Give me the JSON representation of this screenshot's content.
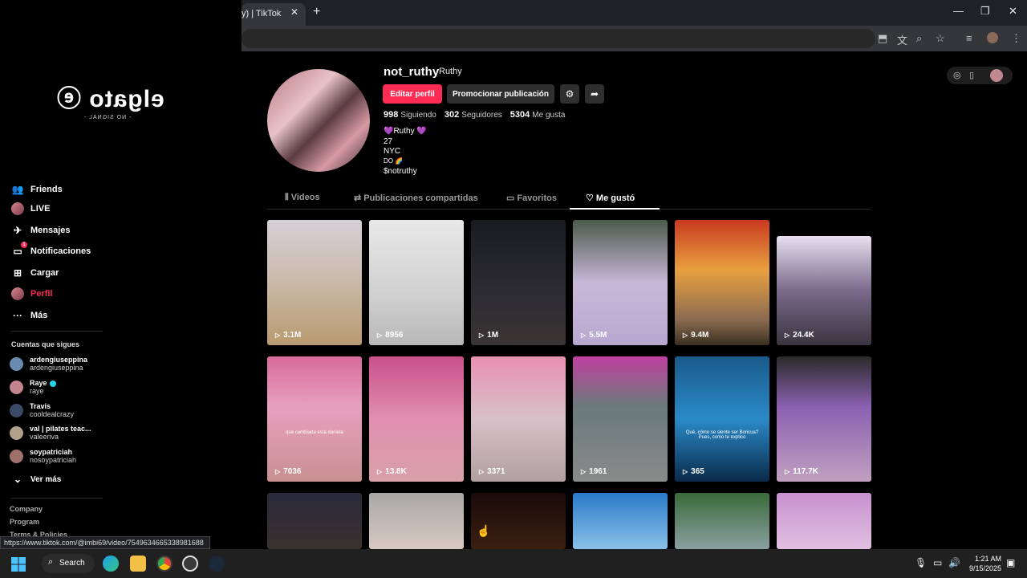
{
  "browser": {
    "tab_title": "y) | TikTok",
    "close_glyph": "✕",
    "new_tab_glyph": "+",
    "minimize_glyph": "—",
    "restore_glyph": "❐",
    "close_window_glyph": "✕"
  },
  "overlay": {
    "logo_text": "elgato",
    "subtitle": "- NO SIGNAL -"
  },
  "sidebar": {
    "items": [
      {
        "label": "Friends",
        "icon": "friends-icon",
        "glyph": "👥"
      },
      {
        "label": "LIVE",
        "icon": "live-avatar-icon",
        "glyph": ""
      },
      {
        "label": "Mensajes",
        "icon": "messages-icon",
        "glyph": "✈"
      },
      {
        "label": "Notificaciones",
        "icon": "notifications-icon",
        "glyph": "💬",
        "badge": "1"
      },
      {
        "label": "Cargar",
        "icon": "upload-icon",
        "glyph": "⊞"
      },
      {
        "label": "Perfil",
        "icon": "profile-avatar-icon",
        "glyph": ""
      },
      {
        "label": "Más",
        "icon": "more-icon",
        "glyph": "···"
      }
    ],
    "following_title": "Cuentas que sigues",
    "following": [
      {
        "name": "ardengiuseppina",
        "username": "ardengiuseppina",
        "color": "#6a8bb0"
      },
      {
        "name": "Raye",
        "username": "raye",
        "verified": true,
        "color": "#c4848f"
      },
      {
        "name": "Travis",
        "username": "cooldealcrazy",
        "color": "#3a4a66"
      },
      {
        "name": "val | pilates teac...",
        "username": "valeeriva",
        "color": "#b3a08a"
      },
      {
        "name": "soypatriciah",
        "username": "nosoypatriciah",
        "color": "#a0706a"
      }
    ],
    "see_more": "Ver más",
    "footer_links": [
      "Company",
      "Program",
      "Terms & Policies"
    ]
  },
  "profile": {
    "username": "not_ruthy",
    "display_name": "Ruthy",
    "edit_button": "Editar perfil",
    "promote_button": "Promocionar publicación",
    "stats": [
      {
        "value": "998",
        "label": "Siguiendo"
      },
      {
        "value": "302",
        "label": "Seguidores"
      },
      {
        "value": "5304",
        "label": "Me gusta"
      }
    ],
    "bio_lines": [
      "💜Ruthy 💜",
      "27",
      "NYC",
      "DO 🌈",
      "$notruthy"
    ]
  },
  "tabs": [
    {
      "label": "Videos",
      "icon": "grid-icon",
      "glyph": "⫴"
    },
    {
      "label": "Publicaciones compartidas",
      "icon": "repost-icon",
      "glyph": "⇄"
    },
    {
      "label": "Favoritos",
      "icon": "bookmark-icon",
      "glyph": "▭"
    },
    {
      "label": "Me gustó",
      "icon": "heart-icon",
      "glyph": "♡",
      "active": true
    }
  ],
  "videos": [
    {
      "views": "3.1M",
      "bg": "linear-gradient(180deg,#d8d0d8 0%,#c9b9a8 50%,#b89a70 100%)"
    },
    {
      "views": "8956",
      "bg": "linear-gradient(180deg,#e8e8e8 0%,#d0d0d0 60%,#b8b8b8 100%)"
    },
    {
      "views": "1M",
      "bg": "linear-gradient(180deg,#1a1a22 0%,#2a2a30 50%,#3a3535 100%)"
    },
    {
      "views": "5.5M",
      "bg": "linear-gradient(180deg,#4a5a4a 0%,#c8b8d8 50%,#b8a8d0 100%)"
    },
    {
      "views": "9.4M",
      "bg": "linear-gradient(180deg,#c83a20 0%,#e8a040 40%,#8a6a50 80%,#3a3020 100%)"
    },
    {
      "views": "24.4K",
      "bg": "linear-gradient(180deg,#e8e0f0 0%,#7a6a8a 50%,#3a3540 100%)"
    },
    {
      "views": "7036",
      "bg": "linear-gradient(180deg,#d86a9a 0%,#e8a0c0 40%,#c89090 100%)"
    },
    {
      "views": "13.8K",
      "bg": "linear-gradient(180deg,#c8508a 0%,#e090b0 50%,#d8a0a8 100%)"
    },
    {
      "views": "3371",
      "bg": "linear-gradient(180deg,#e890b0 0%,#d8c0c8 50%,#b0a0a0 100%)"
    },
    {
      "views": "1961",
      "bg": "linear-gradient(180deg,#c040a0 0%,#6a7a7a 40%,#8a8a8a 100%)"
    },
    {
      "views": "365",
      "bg": "linear-gradient(180deg,#1a5a8a 0%,#2a8ac8 50%,#0a2a4a 100%)"
    },
    {
      "views": "117.7K",
      "bg": "linear-gradient(180deg,#2a2a2a 0%,#8a60b0 40%,#c0a0c0 100%)"
    },
    {
      "views": "",
      "bg": "linear-gradient(180deg,#2a2a3a 0%,#3a3030 100%)"
    },
    {
      "views": "",
      "bg": "linear-gradient(180deg,#a8a8a8 0%,#d8c8c0 100%)"
    },
    {
      "views": "",
      "bg": "linear-gradient(180deg,#1a0a0a 0%,#3a2010 100%)"
    },
    {
      "views": "",
      "bg": "linear-gradient(180deg,#2a7ac8 0%,#8ac0e8 100%)"
    },
    {
      "views": "",
      "bg": "linear-gradient(180deg,#3a6a3a 0%,#8aa0a0 100%)"
    },
    {
      "views": "",
      "bg": "linear-gradient(180deg,#c890d0 0%,#e0c0e0 100%)"
    }
  ],
  "video_captions": {
    "v7": "que cambiada está daniela",
    "v11": "Qué, cómo se siente ser Boricua? Pues, como te explico"
  },
  "status_url": "https://www.tiktok.com/@imbi69/video/7549634665338981688",
  "taskbar": {
    "search_label": "Search",
    "time": "1:21 AM",
    "date": "9/15/2025"
  },
  "colors": {
    "accent": "#fe2c55",
    "background": "#000000"
  }
}
